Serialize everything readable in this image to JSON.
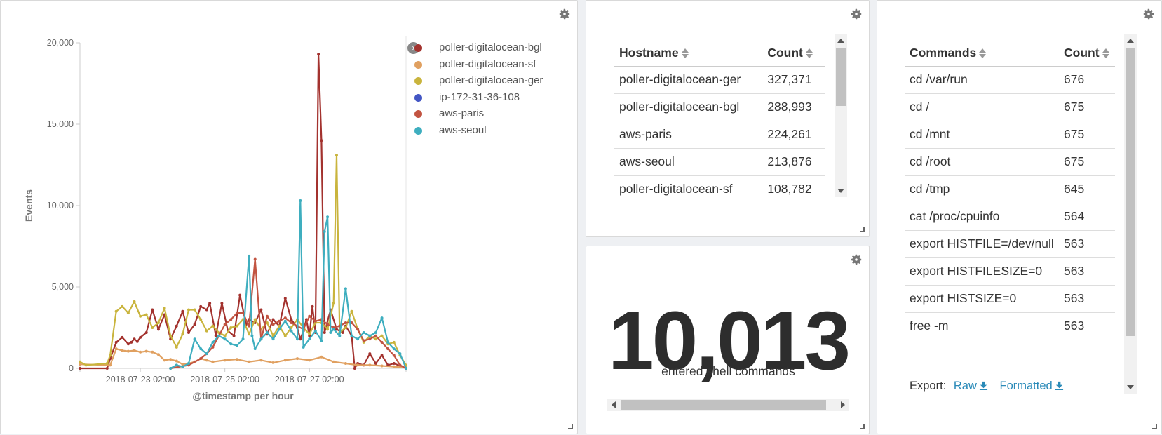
{
  "chart_panel": {
    "chart_data": {
      "type": "line",
      "title": "",
      "xlabel": "@timestamp per hour",
      "ylabel": "Events",
      "ylim": [
        0,
        20000
      ],
      "yticks": [
        0,
        5000,
        10000,
        15000,
        20000
      ],
      "ytick_labels": [
        "0",
        "5,000",
        "10,000",
        "15,000",
        "20,000"
      ],
      "xlim": [
        "2018-07-22 00:00",
        "2018-07-28 00:00"
      ],
      "xtick_labels": [
        "2018-07-23 02:00",
        "2018-07-25 02:00",
        "2018-07-27 02:00"
      ],
      "legend_position": "right",
      "series": [
        {
          "name": "poller-digitalocean-bgl",
          "color": "#a3322e",
          "points": [
            [
              0,
              0
            ],
            [
              9,
              0
            ],
            [
              10,
              600
            ],
            [
              12,
              1600
            ],
            [
              14,
              1900
            ],
            [
              16,
              1500
            ],
            [
              17,
              1600
            ],
            [
              18,
              1800
            ],
            [
              19,
              1650
            ],
            [
              20,
              1900
            ],
            [
              22,
              2200
            ],
            [
              24,
              3600
            ],
            [
              26,
              2400
            ],
            [
              28,
              3300
            ],
            [
              30,
              1800
            ],
            [
              32,
              2600
            ],
            [
              34,
              3500
            ],
            [
              36,
              2200
            ],
            [
              38,
              2700
            ],
            [
              40,
              3800
            ],
            [
              42,
              3600
            ],
            [
              43,
              4000
            ],
            [
              45,
              2000
            ],
            [
              47,
              4000
            ],
            [
              49,
              2300
            ],
            [
              51,
              2000
            ],
            [
              53,
              4500
            ],
            [
              55,
              2700
            ],
            [
              56,
              3000
            ],
            [
              58,
              2800
            ],
            [
              60,
              3600
            ],
            [
              62,
              2100
            ],
            [
              64,
              3000
            ],
            [
              66,
              2600
            ],
            [
              68,
              4300
            ],
            [
              70,
              3000
            ],
            [
              72,
              2500
            ],
            [
              73,
              1800
            ],
            [
              74,
              2300
            ],
            [
              75,
              3000
            ],
            [
              76,
              2000
            ],
            [
              77,
              3800
            ],
            [
              78,
              2200
            ],
            [
              79,
              19300
            ],
            [
              80,
              14000
            ],
            [
              81,
              2200
            ],
            [
              83,
              3600
            ],
            [
              85,
              2400
            ],
            [
              87,
              2200
            ],
            [
              88,
              2600
            ],
            [
              90,
              2000
            ],
            [
              91,
              0
            ],
            [
              92,
              300
            ],
            [
              94,
              200
            ],
            [
              96,
              900
            ],
            [
              98,
              300
            ],
            [
              100,
              800
            ],
            [
              102,
              200
            ],
            [
              104,
              300
            ],
            [
              108,
              0
            ]
          ]
        },
        {
          "name": "poller-digitalocean-sf",
          "color": "#e0a060",
          "points": [
            [
              0,
              250
            ],
            [
              10,
              200
            ],
            [
              12,
              1200
            ],
            [
              14,
              1100
            ],
            [
              16,
              1050
            ],
            [
              18,
              1100
            ],
            [
              20,
              1000
            ],
            [
              22,
              1050
            ],
            [
              24,
              1000
            ],
            [
              26,
              850
            ],
            [
              28,
              500
            ],
            [
              30,
              550
            ],
            [
              32,
              450
            ],
            [
              34,
              250
            ],
            [
              36,
              300
            ],
            [
              38,
              400
            ],
            [
              40,
              600
            ],
            [
              42,
              500
            ],
            [
              44,
              400
            ],
            [
              48,
              500
            ],
            [
              52,
              550
            ],
            [
              56,
              400
            ],
            [
              60,
              500
            ],
            [
              64,
              350
            ],
            [
              68,
              500
            ],
            [
              72,
              600
            ],
            [
              76,
              500
            ],
            [
              80,
              700
            ],
            [
              84,
              400
            ],
            [
              88,
              300
            ],
            [
              92,
              200
            ],
            [
              96,
              200
            ],
            [
              100,
              150
            ],
            [
              104,
              100
            ],
            [
              108,
              50
            ]
          ]
        },
        {
          "name": "poller-digitalocean-ger",
          "color": "#c9b43d",
          "points": [
            [
              0,
              400
            ],
            [
              2,
              200
            ],
            [
              9,
              300
            ],
            [
              10,
              800
            ],
            [
              12,
              3500
            ],
            [
              14,
              3800
            ],
            [
              16,
              3400
            ],
            [
              18,
              4100
            ],
            [
              20,
              3200
            ],
            [
              22,
              3300
            ],
            [
              24,
              2500
            ],
            [
              26,
              2800
            ],
            [
              28,
              3700
            ],
            [
              30,
              2000
            ],
            [
              32,
              1300
            ],
            [
              34,
              2100
            ],
            [
              36,
              3600
            ],
            [
              38,
              3600
            ],
            [
              40,
              3000
            ],
            [
              42,
              2300
            ],
            [
              44,
              2600
            ],
            [
              46,
              2200
            ],
            [
              48,
              2000
            ],
            [
              50,
              2500
            ],
            [
              52,
              2600
            ],
            [
              54,
              3000
            ],
            [
              56,
              2100
            ],
            [
              58,
              3000
            ],
            [
              60,
              2400
            ],
            [
              62,
              2800
            ],
            [
              64,
              2000
            ],
            [
              66,
              2600
            ],
            [
              68,
              2000
            ],
            [
              70,
              2500
            ],
            [
              72,
              3000
            ],
            [
              74,
              2500
            ],
            [
              76,
              2100
            ],
            [
              78,
              2800
            ],
            [
              80,
              2800
            ],
            [
              82,
              2400
            ],
            [
              84,
              4000
            ],
            [
              85,
              13100
            ],
            [
              86,
              2200
            ],
            [
              88,
              2500
            ],
            [
              90,
              3500
            ],
            [
              92,
              2400
            ],
            [
              94,
              1600
            ],
            [
              96,
              2000
            ],
            [
              98,
              1800
            ],
            [
              100,
              2000
            ],
            [
              102,
              1500
            ],
            [
              104,
              1600
            ],
            [
              106,
              800
            ],
            [
              108,
              200
            ]
          ]
        },
        {
          "name": "ip-172-31-36-108",
          "color": "#4356c4",
          "points": []
        },
        {
          "name": "aws-paris",
          "color": "#c25441",
          "points": [
            [
              30,
              0
            ],
            [
              36,
              200
            ],
            [
              40,
              600
            ],
            [
              42,
              900
            ],
            [
              44,
              1300
            ],
            [
              46,
              2000
            ],
            [
              48,
              2700
            ],
            [
              50,
              3000
            ],
            [
              52,
              3400
            ],
            [
              54,
              3400
            ],
            [
              56,
              2600
            ],
            [
              58,
              6700
            ],
            [
              60,
              1800
            ],
            [
              62,
              3200
            ],
            [
              64,
              2700
            ],
            [
              66,
              2900
            ],
            [
              68,
              3100
            ],
            [
              70,
              2800
            ],
            [
              72,
              2600
            ],
            [
              74,
              2400
            ],
            [
              76,
              3200
            ],
            [
              78,
              2900
            ],
            [
              80,
              3000
            ],
            [
              82,
              2700
            ],
            [
              84,
              2500
            ],
            [
              86,
              2600
            ],
            [
              88,
              2800
            ],
            [
              90,
              2800
            ],
            [
              92,
              2400
            ],
            [
              94,
              1700
            ],
            [
              96,
              1800
            ],
            [
              98,
              2000
            ],
            [
              100,
              1600
            ],
            [
              102,
              1200
            ],
            [
              104,
              800
            ],
            [
              106,
              200
            ],
            [
              108,
              0
            ]
          ]
        },
        {
          "name": "aws-seoul",
          "color": "#3eaebf",
          "points": [
            [
              30,
              0
            ],
            [
              32,
              200
            ],
            [
              34,
              100
            ],
            [
              36,
              300
            ],
            [
              38,
              1800
            ],
            [
              40,
              1200
            ],
            [
              42,
              900
            ],
            [
              44,
              1600
            ],
            [
              46,
              2000
            ],
            [
              48,
              1800
            ],
            [
              50,
              1500
            ],
            [
              52,
              1400
            ],
            [
              54,
              1800
            ],
            [
              56,
              6900
            ],
            [
              57,
              2000
            ],
            [
              58,
              1200
            ],
            [
              60,
              1800
            ],
            [
              62,
              2200
            ],
            [
              64,
              1800
            ],
            [
              66,
              2400
            ],
            [
              68,
              2900
            ],
            [
              70,
              2300
            ],
            [
              72,
              1800
            ],
            [
              73,
              10300
            ],
            [
              74,
              1300
            ],
            [
              76,
              1800
            ],
            [
              78,
              2300
            ],
            [
              80,
              1700
            ],
            [
              81,
              8400
            ],
            [
              82,
              9300
            ],
            [
              83,
              2200
            ],
            [
              84,
              2400
            ],
            [
              86,
              2000
            ],
            [
              88,
              4900
            ],
            [
              90,
              2000
            ],
            [
              92,
              1800
            ],
            [
              94,
              2200
            ],
            [
              96,
              2000
            ],
            [
              98,
              2200
            ],
            [
              100,
              3100
            ],
            [
              102,
              1600
            ],
            [
              104,
              1200
            ],
            [
              106,
              900
            ],
            [
              108,
              0
            ]
          ]
        }
      ]
    }
  },
  "hosts_panel": {
    "columns": [
      "Hostname",
      "Count"
    ],
    "rows": [
      [
        "poller-digitalocean-ger",
        "327,371"
      ],
      [
        "poller-digitalocean-bgl",
        "288,993"
      ],
      [
        "aws-paris",
        "224,261"
      ],
      [
        "aws-seoul",
        "213,876"
      ],
      [
        "poller-digitalocean-sf",
        "108,782"
      ]
    ]
  },
  "metric_panel": {
    "value": "10,013",
    "label": "entered shell commands"
  },
  "commands_panel": {
    "columns": [
      "Commands",
      "Count"
    ],
    "rows": [
      [
        "cd /var/run",
        "676"
      ],
      [
        "cd /",
        "675"
      ],
      [
        "cd /mnt",
        "675"
      ],
      [
        "cd /root",
        "675"
      ],
      [
        "cd /tmp",
        "645"
      ],
      [
        "cat /proc/cpuinfo",
        "564"
      ],
      [
        "export HISTFILE=/dev/null",
        "563"
      ],
      [
        "export HISTFILESIZE=0",
        "563"
      ],
      [
        "export HISTSIZE=0",
        "563"
      ],
      [
        "free -m",
        "563"
      ]
    ],
    "export_label": "Export:",
    "export_raw": "Raw",
    "export_formatted": "Formatted"
  },
  "icons": {
    "settings": "gear-icon",
    "resize": "resize-handle-icon",
    "legend_toggle": "chevron-right-icon",
    "sort": "sort-icon",
    "download": "download-icon"
  },
  "colors": {
    "link": "#2a8ab8",
    "metric_text": "#2d2d2d"
  }
}
